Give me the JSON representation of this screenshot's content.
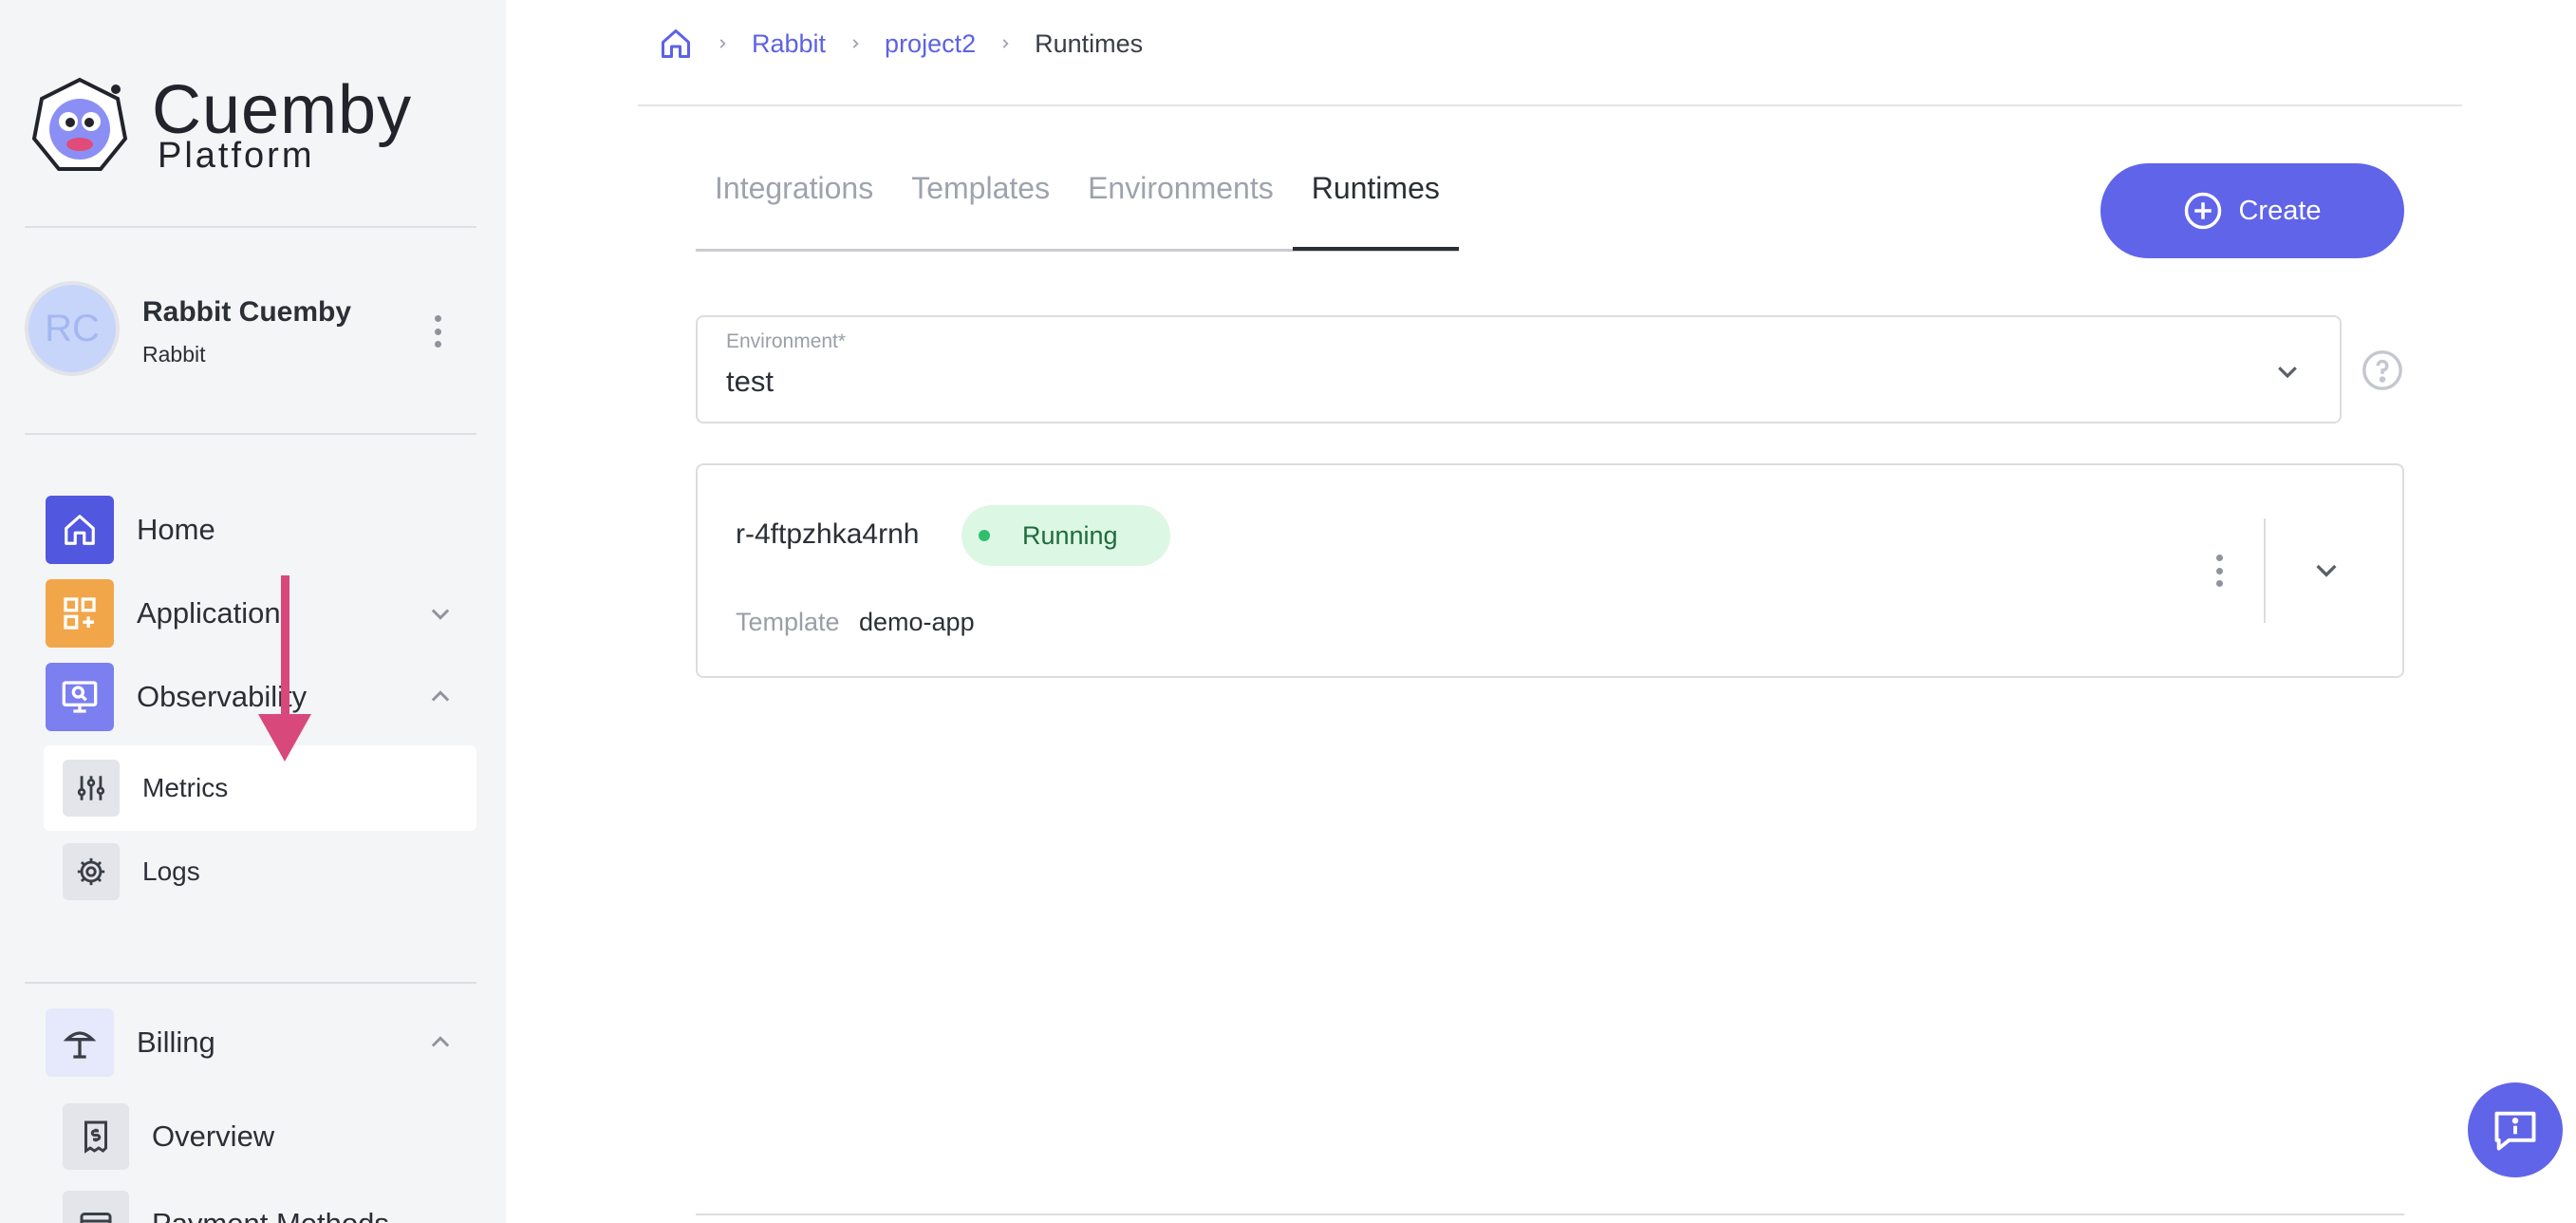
{
  "brand": {
    "name": "Cuemby",
    "subtitle": "Platform",
    "colors": {
      "accent": "#6064e9",
      "sidebar_bg": "#f4f5f7",
      "success_bg": "#dcf8e4",
      "success_dot": "#2fbf6c"
    }
  },
  "user": {
    "initials": "RC",
    "name": "Rabbit Cuemby",
    "org": "Rabbit",
    "menu_icon": "kebab-vertical-icon"
  },
  "nav": {
    "home": {
      "label": "Home",
      "icon": "home-icon",
      "color": "#5257e0"
    },
    "application": {
      "label": "Application",
      "icon": "apps-add-icon",
      "color": "#f2a64a"
    },
    "observability": {
      "label": "Observability",
      "icon": "monitor-search-icon",
      "color": "#7b7ff0",
      "children": [
        {
          "label": "Metrics",
          "icon": "sliders-icon"
        },
        {
          "label": "Logs",
          "icon": "gear-icon"
        }
      ]
    },
    "billing": {
      "label": "Billing",
      "icon": "billing-icon",
      "children": [
        {
          "label": "Overview",
          "icon": "receipt-dollar-icon"
        },
        {
          "label": "Payment Methods",
          "icon": "credit-card-icon"
        }
      ]
    }
  },
  "breadcrumb": {
    "home_icon": "home-icon",
    "items": [
      "Rabbit",
      "project2",
      "Runtimes"
    ]
  },
  "tabs": [
    {
      "label": "Integrations",
      "active": false
    },
    {
      "label": "Templates",
      "active": false
    },
    {
      "label": "Environments",
      "active": false
    },
    {
      "label": "Runtimes",
      "active": true
    }
  ],
  "create_button": {
    "label": "Create",
    "icon": "plus-circle-icon"
  },
  "environment_select": {
    "label": "Environment*",
    "value": "test"
  },
  "runtime": {
    "name": "r-4ftpzhka4rnh",
    "status": "Running",
    "template_label": "Template",
    "template_value": "demo-app"
  },
  "chat_icon": "chat-info-icon"
}
